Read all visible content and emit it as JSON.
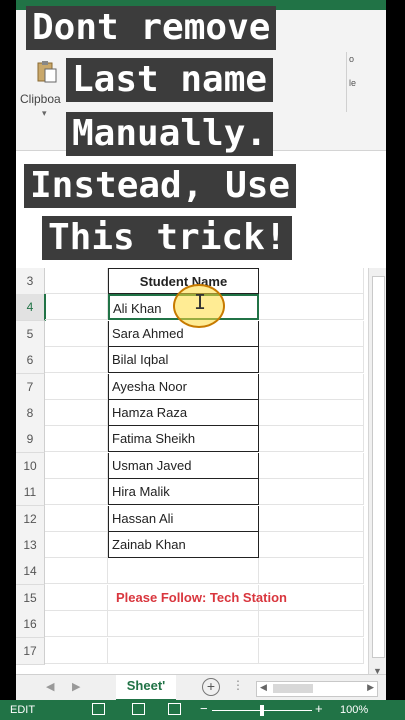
{
  "ribbon": {
    "clipboard_label": "Clipboa",
    "right_fragment_1": "o",
    "right_fragment_2": "le"
  },
  "rows": [
    {
      "num": "3",
      "name": "Student Name",
      "type": "header"
    },
    {
      "num": "4",
      "name": "Ali Khan",
      "type": "data",
      "selected": true
    },
    {
      "num": "5",
      "name": "Sara Ahmed",
      "type": "data"
    },
    {
      "num": "6",
      "name": "Bilal Iqbal",
      "type": "data"
    },
    {
      "num": "7",
      "name": "Ayesha Noor",
      "type": "data"
    },
    {
      "num": "8",
      "name": "Hamza Raza",
      "type": "data"
    },
    {
      "num": "9",
      "name": "Fatima Sheikh",
      "type": "data"
    },
    {
      "num": "10",
      "name": "Usman Javed",
      "type": "data"
    },
    {
      "num": "11",
      "name": "Hira Malik",
      "type": "data"
    },
    {
      "num": "12",
      "name": "Hassan Ali",
      "type": "data"
    },
    {
      "num": "13",
      "name": "Zainab Khan",
      "type": "data"
    },
    {
      "num": "14",
      "name": "",
      "type": "empty"
    },
    {
      "num": "15",
      "name": "",
      "type": "empty"
    },
    {
      "num": "16",
      "name": "",
      "type": "empty"
    },
    {
      "num": "17",
      "name": "",
      "type": "empty"
    }
  ],
  "footer_note": "Please Follow: Tech Station",
  "sheet_tab": "Sheet'",
  "status": {
    "mode": "EDIT",
    "zoom": "100%"
  },
  "caption": [
    "Dont remove",
    "Last name",
    "Manually.",
    "Instead, Use",
    "This trick!"
  ],
  "colors": {
    "accent": "#217346",
    "note": "#d9363e",
    "caption_bg": "#3c3c3c"
  }
}
